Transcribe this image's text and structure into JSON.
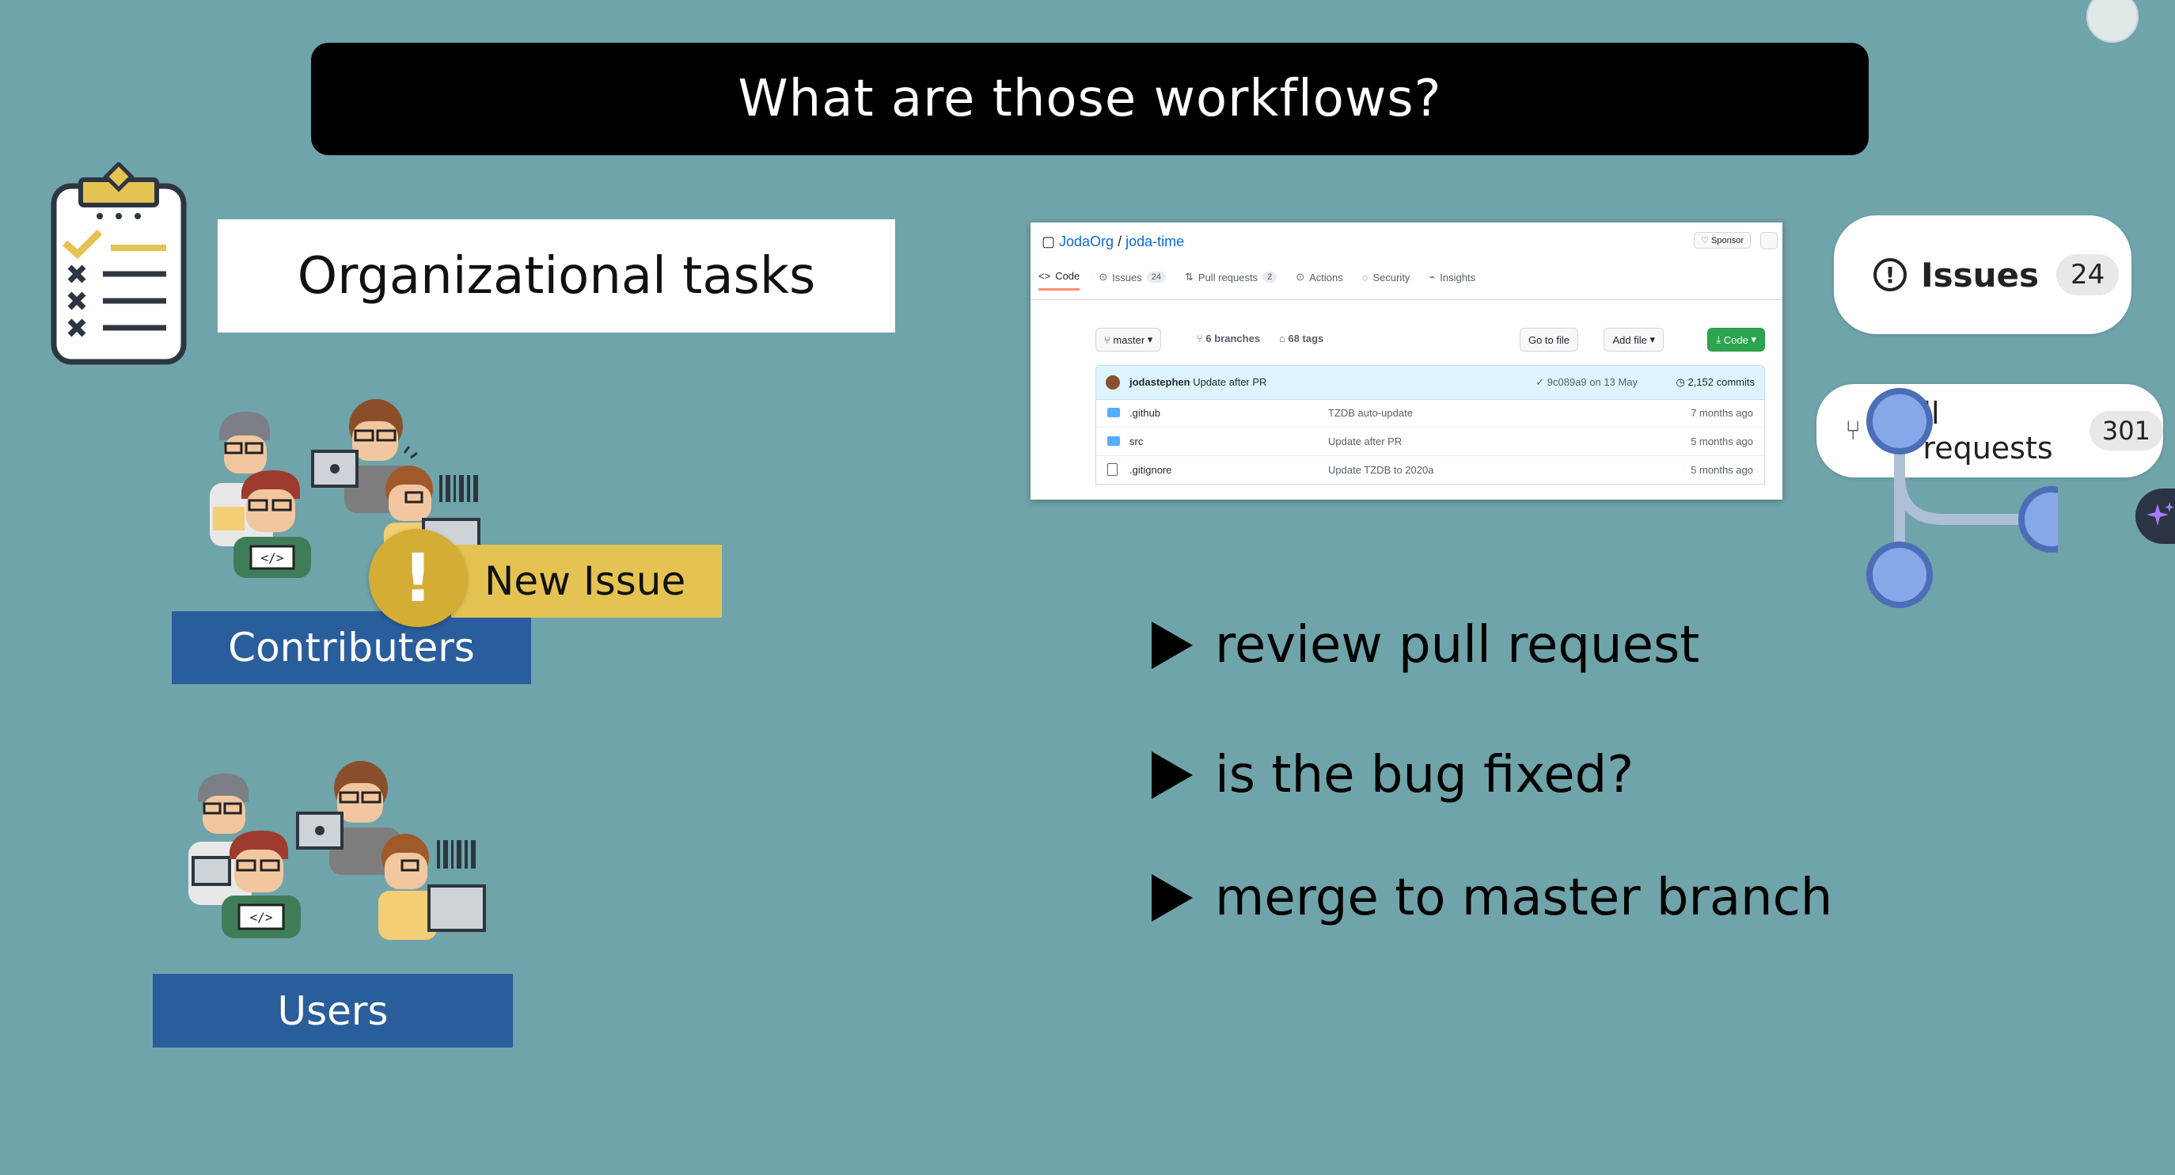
{
  "title": "What are those workflows?",
  "organizational": {
    "label": "Organizational tasks",
    "icon": "clipboard-checklist-icon"
  },
  "contributors": {
    "label": "Contributers",
    "icon": "developer-group-icon"
  },
  "new_issue": {
    "label": "New Issue",
    "mark": "!"
  },
  "users": {
    "label": "Users",
    "icon": "developer-group-icon"
  },
  "github": {
    "owner": "JodaOrg",
    "separator": " / ",
    "repo": "joda-time",
    "sponsor": "Sponsor",
    "tabs": [
      {
        "label": "Code",
        "icon": "code-icon"
      },
      {
        "label": "Issues",
        "count": "24",
        "icon": "issue-icon"
      },
      {
        "label": "Pull requests",
        "count": "2",
        "icon": "pull-request-icon"
      },
      {
        "label": "Actions",
        "icon": "play-icon"
      },
      {
        "label": "Security",
        "icon": "shield-icon"
      },
      {
        "label": "Insights",
        "icon": "graph-icon"
      }
    ],
    "branch": "master",
    "branches": "6 branches",
    "tags": "68 tags",
    "go_to_file": "Go to file",
    "add_file": "Add file",
    "code_button": "Code",
    "commit": {
      "author": "jodastephen",
      "message": "Update after PR",
      "sha": "9c089a9",
      "date": "on 13 May",
      "commits": "2,152 commits"
    },
    "files": [
      {
        "name": ".github",
        "message": "TZDB auto-update",
        "age": "7 months ago",
        "type": "folder"
      },
      {
        "name": "src",
        "message": "Update after PR",
        "age": "5 months ago",
        "type": "folder"
      },
      {
        "name": ".gitignore",
        "message": "Update TZDB to 2020a",
        "age": "5 months ago",
        "type": "file"
      }
    ]
  },
  "issues_pill": {
    "label": "Issues",
    "count": "24"
  },
  "pr_pill": {
    "label": "ll requests",
    "count": "301"
  },
  "bullets": [
    "review pull request",
    "is the bug fixed?",
    "merge to master branch"
  ],
  "colors": {
    "background": "#6fa4aa",
    "label_blue": "#2a5d9c",
    "issue_yellow": "#e4c352",
    "graph_node": "#86a8e8"
  }
}
